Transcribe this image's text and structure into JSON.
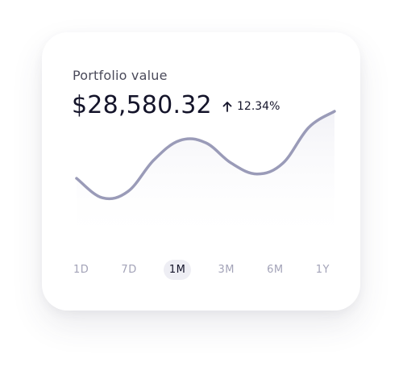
{
  "card": {
    "title": "Portfolio value",
    "value": "$28,580.32",
    "change": "12.34%",
    "change_icon": "arrow-up-icon"
  },
  "ranges": [
    {
      "label": "1D",
      "active": false
    },
    {
      "label": "7D",
      "active": false
    },
    {
      "label": "1M",
      "active": true
    },
    {
      "label": "3M",
      "active": false
    },
    {
      "label": "6M",
      "active": false
    },
    {
      "label": "1Y",
      "active": false
    }
  ],
  "colors": {
    "line": "#9a9bb8",
    "text": "#14142a",
    "muted": "#a3a3b8",
    "active_bg": "#eeeef4"
  },
  "chart_data": {
    "type": "line",
    "title": "",
    "xlabel": "",
    "ylabel": "",
    "x": [
      0,
      1,
      2,
      3,
      4,
      5,
      6,
      7,
      8,
      9,
      10
    ],
    "values": [
      0.38,
      0.2,
      0.26,
      0.55,
      0.73,
      0.71,
      0.52,
      0.42,
      0.52,
      0.85,
      1.0
    ],
    "ylim": [
      0,
      1
    ],
    "grid": false
  }
}
